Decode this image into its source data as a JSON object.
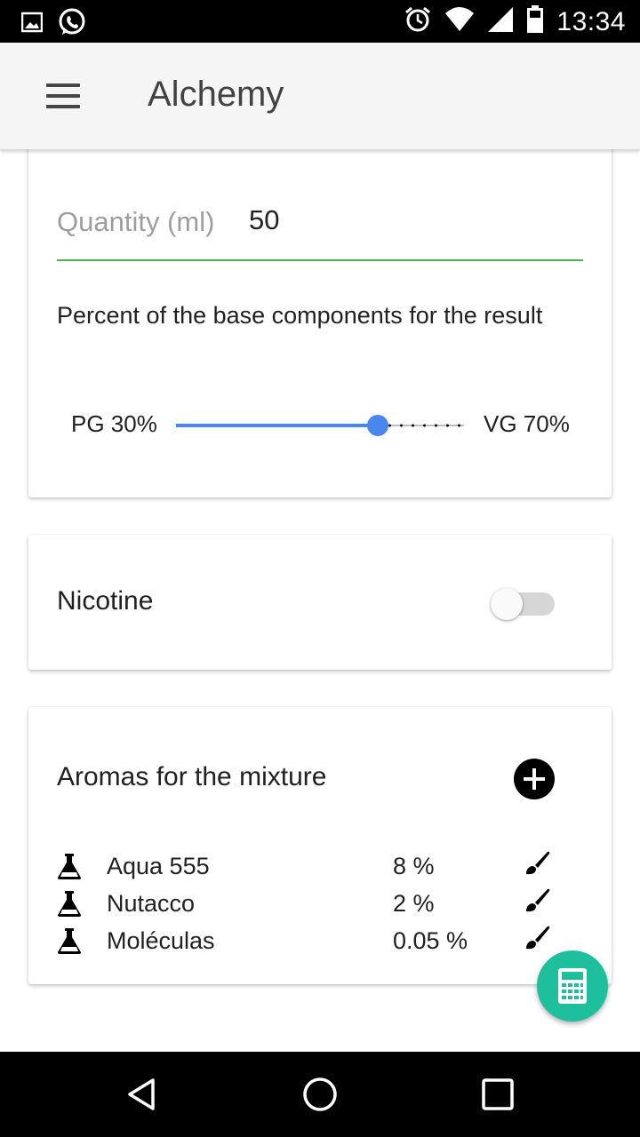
{
  "status_bar": {
    "time": "13:34",
    "left_icons": [
      "image-icon",
      "whatsapp-icon"
    ],
    "right_icons": [
      "alarm-icon",
      "wifi-icon",
      "signal-icon",
      "battery-icon"
    ]
  },
  "app_bar": {
    "title": "Alchemy",
    "menu_icon": "menu-icon"
  },
  "base_card": {
    "quantity_label": "Quantity (ml)",
    "quantity_value": "50",
    "percent_text": "Percent of the base components for the result",
    "pg_label": "PG 30%",
    "vg_label": "VG 70%",
    "slider_value_fraction": 0.7,
    "accent_color": "#4caf50",
    "slider_color": "#4a86f0"
  },
  "nicotine_card": {
    "label": "Nicotine",
    "enabled": false
  },
  "aromas_card": {
    "title": "Aromas for the mixture",
    "add_icon": "add-circle-icon",
    "items": [
      {
        "name": "Aqua 555",
        "percent": "8 %",
        "icon": "flask-icon",
        "action_icon": "brush-icon"
      },
      {
        "name": "Nutacco",
        "percent": "2 %",
        "icon": "flask-icon",
        "action_icon": "brush-icon"
      },
      {
        "name": "Moléculas",
        "percent": "0.05 %",
        "icon": "flask-icon",
        "action_icon": "brush-icon"
      }
    ]
  },
  "fab": {
    "icon": "calculator-icon",
    "color": "#1dbf9c"
  },
  "nav_bar": {
    "icons": [
      "back-icon",
      "home-icon",
      "recents-icon"
    ]
  }
}
